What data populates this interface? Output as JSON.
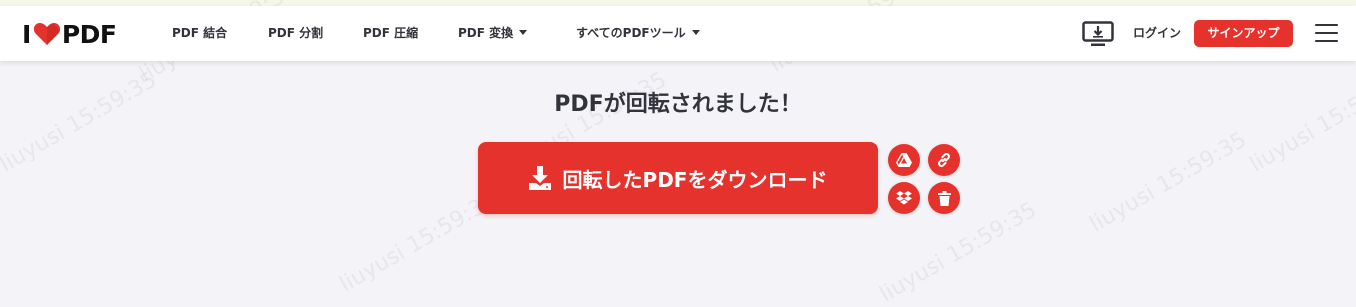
{
  "header": {
    "logo": {
      "letter_i": "I",
      "letters_pdf": "PDF"
    },
    "nav": [
      {
        "label": "PDF 結合",
        "has_caret": false
      },
      {
        "label": "PDF 分割",
        "has_caret": false
      },
      {
        "label": "PDF 圧縮",
        "has_caret": false
      },
      {
        "label": "PDF 変換",
        "has_caret": true
      },
      {
        "label": "すべてのPDFツール",
        "has_caret": true
      }
    ],
    "desktop_icon": "desktop-download-icon",
    "login_label": "ログイン",
    "signup_label": "サインアップ",
    "menu_icon": "hamburger-menu-icon"
  },
  "main": {
    "title": "PDFが回転されました！",
    "download_label": "回転したPDFをダウンロード",
    "download_icon": "download-icon",
    "side_actions": [
      {
        "name": "google-drive-button",
        "icon": "google-drive-icon"
      },
      {
        "name": "copy-link-button",
        "icon": "link-icon"
      },
      {
        "name": "dropbox-button",
        "icon": "dropbox-icon"
      },
      {
        "name": "delete-button",
        "icon": "trash-icon"
      }
    ]
  },
  "watermark": {
    "text": "liuyusi 15:59:35"
  },
  "colors": {
    "accent": "#e5322d",
    "background": "#f4f4f8",
    "text": "#33333b"
  }
}
